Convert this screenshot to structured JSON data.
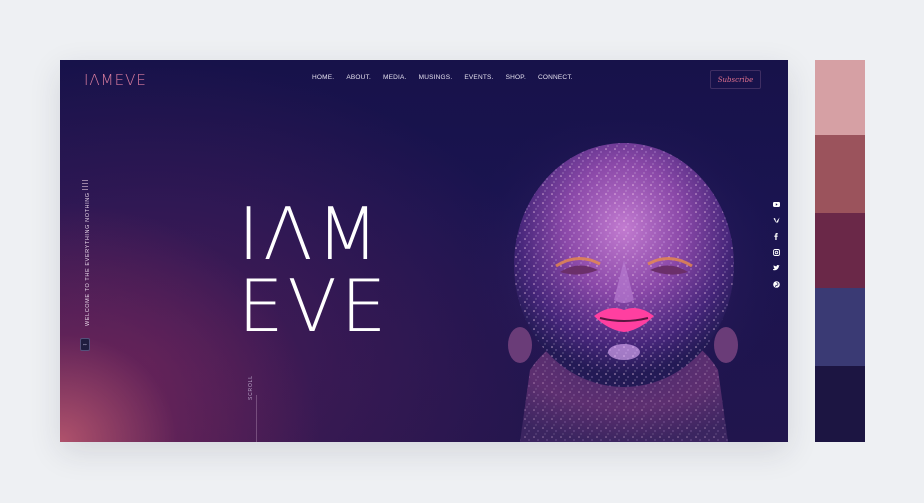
{
  "header": {
    "logo": "IΛMEVE",
    "nav": [
      "HOME.",
      "ABOUT.",
      "MEDIA.",
      "MUSINGS.",
      "EVENTS.",
      "SHOP.",
      "CONNECT."
    ],
    "subscribe_label": "Subscribe"
  },
  "hero": {
    "line1": "IΛM",
    "line2": "EVE",
    "side_tagline": "WELCOME TO THE EVERYTHING NOTHING",
    "scroll_label": "SCROLL"
  },
  "social_icons": [
    "youtube-icon",
    "vimeo-icon",
    "facebook-icon",
    "instagram-icon",
    "twitter-icon",
    "pinterest-icon"
  ],
  "palette": [
    "#d6a0a4",
    "#9b535c",
    "#6a2848",
    "#3a3a74",
    "#1c1542"
  ],
  "colors": {
    "accent": "#d87c9e",
    "background": "#1a1450"
  }
}
